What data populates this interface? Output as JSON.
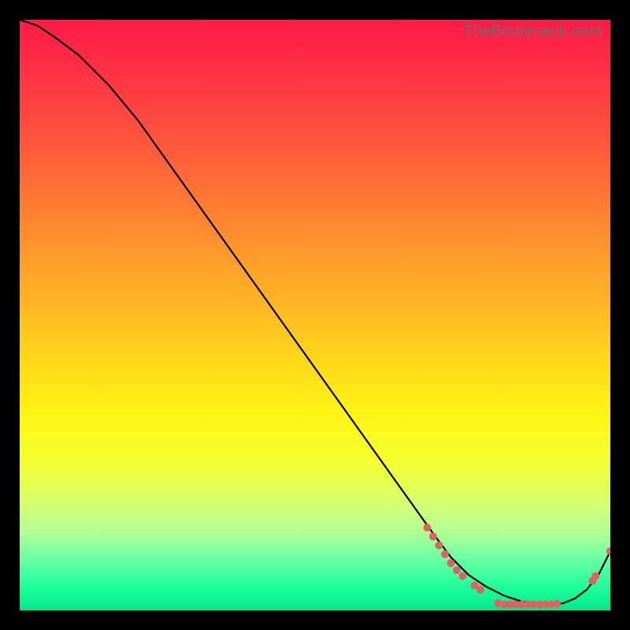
{
  "watermark": "TheBottleneck.com",
  "chart_data": {
    "type": "line",
    "title": "",
    "xlabel": "",
    "ylabel": "",
    "xlim": [
      0,
      100
    ],
    "ylim": [
      0,
      100
    ],
    "grid": false,
    "legend": false,
    "series": [
      {
        "name": "curve",
        "x": [
          0,
          3,
          6,
          10,
          15,
          20,
          25,
          30,
          35,
          40,
          45,
          50,
          55,
          60,
          65,
          70,
          73,
          76,
          79,
          82,
          85,
          88,
          90,
          92,
          94,
          96,
          98,
          100
        ],
        "y": [
          100,
          99,
          97,
          94,
          89,
          83,
          76,
          69,
          62,
          55,
          48,
          41,
          34,
          27,
          20,
          13,
          9,
          6,
          4,
          2.5,
          1.5,
          1,
          1,
          1.2,
          2,
          3.5,
          6,
          10
        ]
      }
    ],
    "markers": [
      {
        "x": 69,
        "y": 14.0
      },
      {
        "x": 70,
        "y": 12.5
      },
      {
        "x": 71,
        "y": 11.0
      },
      {
        "x": 72,
        "y": 9.5
      },
      {
        "x": 73,
        "y": 8.0
      },
      {
        "x": 74,
        "y": 6.8
      },
      {
        "x": 75,
        "y": 5.8
      },
      {
        "x": 77,
        "y": 4.2
      },
      {
        "x": 78,
        "y": 3.5
      },
      {
        "x": 81,
        "y": 1.2
      },
      {
        "x": 82,
        "y": 1.0
      },
      {
        "x": 83,
        "y": 1.0
      },
      {
        "x": 84,
        "y": 1.0
      },
      {
        "x": 85,
        "y": 1.0
      },
      {
        "x": 86,
        "y": 1.0
      },
      {
        "x": 87,
        "y": 1.0
      },
      {
        "x": 88,
        "y": 1.0
      },
      {
        "x": 89,
        "y": 1.0
      },
      {
        "x": 90,
        "y": 1.0
      },
      {
        "x": 91,
        "y": 1.1
      },
      {
        "x": 97,
        "y": 5.0
      },
      {
        "x": 97.5,
        "y": 5.8
      },
      {
        "x": 100,
        "y": 10.0
      }
    ],
    "background_gradient": {
      "direction": "vertical",
      "stops": [
        {
          "pos": 0,
          "color": "#ff1a46"
        },
        {
          "pos": 50,
          "color": "#ffc81e"
        },
        {
          "pos": 75,
          "color": "#f0ff40"
        },
        {
          "pos": 100,
          "color": "#00e88a"
        }
      ]
    }
  }
}
